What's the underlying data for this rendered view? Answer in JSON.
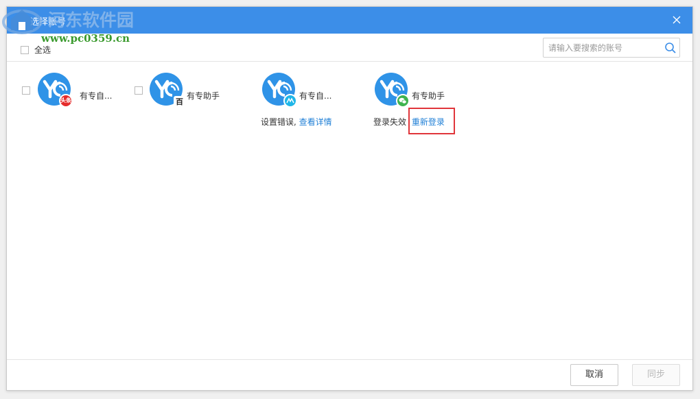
{
  "window": {
    "title": "选择账号",
    "close_icon": "close-icon"
  },
  "watermark": {
    "text": "河东软件园",
    "url": "www.pc0359.cn"
  },
  "toolbar": {
    "select_all_label": "全选"
  },
  "search": {
    "placeholder": "请输入要搜索的账号",
    "value": "",
    "icon": "search-icon"
  },
  "accounts": [
    {
      "name": "有专自...",
      "platform_badge": "头条",
      "badge_icon": "toutiao-icon",
      "status": "",
      "action": ""
    },
    {
      "name": "有专助手",
      "platform_badge": "百",
      "badge_icon": "baidu-icon",
      "status": "",
      "action": ""
    },
    {
      "name": "有专自...",
      "platform_badge": "",
      "badge_icon": "dayu-icon",
      "status": "设置错误,",
      "action": "查看详情"
    },
    {
      "name": "有专助手",
      "platform_badge": "",
      "badge_icon": "wechat-icon",
      "status": "登录失效",
      "action": "重新登录"
    }
  ],
  "footer": {
    "cancel_label": "取消",
    "sync_label": "同步"
  },
  "colors": {
    "titlebar": "#3c8ee8",
    "avatar": "#2f93e7",
    "link": "#1f7fd6",
    "highlight": "#e0353a"
  }
}
